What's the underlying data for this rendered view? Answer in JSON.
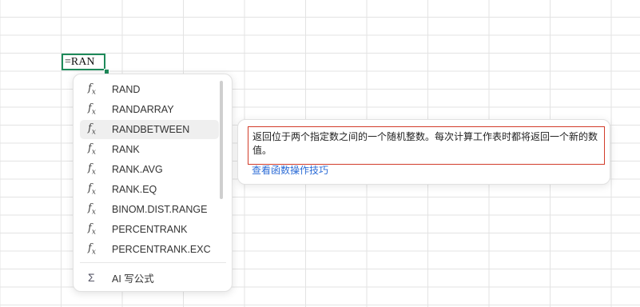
{
  "cell_editor": {
    "text": "=RAN"
  },
  "autocomplete": {
    "items": [
      {
        "icon": "function-icon",
        "label": "RAND"
      },
      {
        "icon": "function-icon",
        "label": "RANDARRAY"
      },
      {
        "icon": "function-icon",
        "label": "RANDBETWEEN",
        "selected": true
      },
      {
        "icon": "function-icon",
        "label": "RANK"
      },
      {
        "icon": "function-icon",
        "label": "RANK.AVG"
      },
      {
        "icon": "function-icon",
        "label": "RANK.EQ"
      },
      {
        "icon": "function-icon",
        "label": "BINOM.DIST.RANGE"
      },
      {
        "icon": "function-icon",
        "label": "PERCENTRANK"
      },
      {
        "icon": "function-icon",
        "label": "PERCENTRANK.EXC"
      }
    ],
    "ai_item": {
      "icon": "sigma-icon",
      "label": "AI 写公式"
    }
  },
  "tooltip": {
    "description": "返回位于两个指定数之间的一个随机整数。每次计算工作表时都将返回一个新的数值。",
    "link": "查看函数操作技巧"
  },
  "colors": {
    "cell_border": "#1e8a5a",
    "highlight_border": "#d23c2a",
    "link": "#2b6bd6"
  }
}
